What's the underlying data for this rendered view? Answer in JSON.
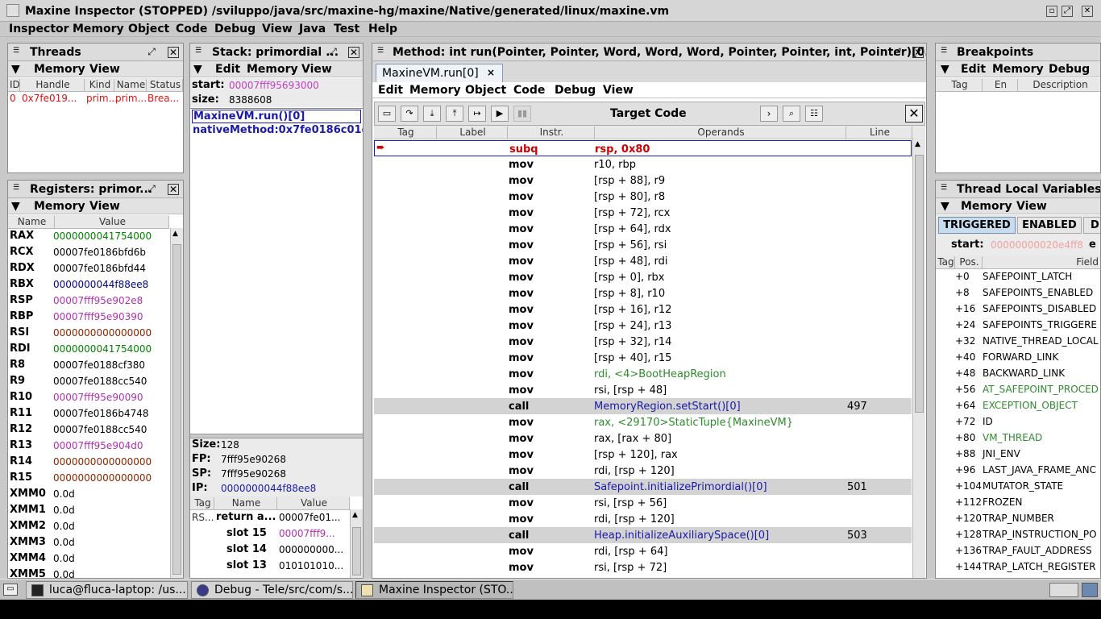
{
  "window": {
    "title": "Maxine Inspector (STOPPED) /sviluppo/java/src/maxine-hg/maxine/Native/generated/linux/maxine.vm",
    "menu": [
      "Inspector",
      "Memory",
      "Object",
      "Code",
      "Debug",
      "View",
      "Java",
      "Test",
      "Help"
    ]
  },
  "threads": {
    "title": "Threads",
    "menu": [
      "Memory",
      "View"
    ],
    "columns": [
      "ID",
      "Handle",
      "Kind",
      "Name",
      "Status"
    ],
    "row": [
      "0",
      "0x7fe019...",
      "prim...",
      "prim...",
      "Brea..."
    ]
  },
  "registers": {
    "title": "Registers: primor...",
    "menu": [
      "Memory",
      "View"
    ],
    "columns": [
      "Name",
      "Value"
    ],
    "rows": [
      {
        "name": "RAX",
        "value": "0000000041754000",
        "color": "#008000"
      },
      {
        "name": "RCX",
        "value": "00007fe0186bfd6b",
        "color": "#000000"
      },
      {
        "name": "RDX",
        "value": "00007fe0186bfd44",
        "color": "#000000"
      },
      {
        "name": "RBX",
        "value": "0000000044f88ee8",
        "color": "#00008b"
      },
      {
        "name": "RSP",
        "value": "00007fff95e902e8",
        "color": "#b030b0"
      },
      {
        "name": "RBP",
        "value": "00007fff95e90390",
        "color": "#b030b0"
      },
      {
        "name": "RSI",
        "value": "0000000000000000",
        "color": "#8b2500"
      },
      {
        "name": "RDI",
        "value": "0000000041754000",
        "color": "#008000"
      },
      {
        "name": "R8",
        "value": "00007fe0188cf380",
        "color": "#000000"
      },
      {
        "name": "R9",
        "value": "00007fe0188cc540",
        "color": "#000000"
      },
      {
        "name": "R10",
        "value": "00007fff95e90090",
        "color": "#b030b0"
      },
      {
        "name": "R11",
        "value": "00007fe0186b4748",
        "color": "#000000"
      },
      {
        "name": "R12",
        "value": "00007fe0188cc540",
        "color": "#000000"
      },
      {
        "name": "R13",
        "value": "00007fff95e904d0",
        "color": "#b030b0"
      },
      {
        "name": "R14",
        "value": "0000000000000000",
        "color": "#8b2500"
      },
      {
        "name": "R15",
        "value": "0000000000000000",
        "color": "#8b2500"
      },
      {
        "name": "XMM0",
        "value": "0.0d",
        "color": "#000000"
      },
      {
        "name": "XMM1",
        "value": "0.0d",
        "color": "#000000"
      },
      {
        "name": "XMM2",
        "value": "0.0d",
        "color": "#000000"
      },
      {
        "name": "XMM3",
        "value": "0.0d",
        "color": "#000000"
      },
      {
        "name": "XMM4",
        "value": "0.0d",
        "color": "#000000"
      },
      {
        "name": "XMM5",
        "value": "0.0d",
        "color": "#000000"
      }
    ]
  },
  "stack": {
    "title": "Stack: primordial ...",
    "menu": [
      "Edit",
      "Memory",
      "View"
    ],
    "start_label": "start:",
    "start_value": "00007fff95693000",
    "size_label": "size:",
    "size_value": "8388608",
    "frames": [
      "MaxineVM.run()[0]",
      "nativeMethod:0x7fe0186c01d4"
    ],
    "size2_label": "Size:",
    "size2_value": "128",
    "fp_label": "FP:",
    "fp_value": "7fff95e90268",
    "sp_label": "SP:",
    "sp_value": "7fff95e90268",
    "ip_label": "IP:",
    "ip_value": "0000000044f88ee8",
    "slot_columns": [
      "Tag",
      "Name",
      "Value"
    ],
    "slots": [
      {
        "tag": "RS...",
        "name": "return a...",
        "value": "00007fe01...",
        "color": "#000000"
      },
      {
        "tag": "",
        "name": "slot 15",
        "value": "00007fff9...",
        "color": "#b030b0"
      },
      {
        "tag": "",
        "name": "slot 14",
        "value": "000000000...",
        "color": "#000000"
      },
      {
        "tag": "",
        "name": "slot 13",
        "value": "010101010...",
        "color": "#000000"
      }
    ]
  },
  "method": {
    "title": "Method: int run(Pointer, Pointer, Word, Word, Word, Pointer, Pointer, int, Pointer)[0...",
    "tab": "MaxineVM.run[0]",
    "menu": [
      "Edit",
      "Memory",
      "Object",
      "Code",
      "Debug",
      "View"
    ],
    "toolbar_title": "Target Code",
    "columns": [
      "Tag",
      "Label",
      "Instr.",
      "Operands",
      "Line"
    ],
    "rows": [
      {
        "ins": "subq",
        "op": "rsp, 0x80",
        "line": "",
        "hl": false,
        "opcolor": "#d00000",
        "inscolor": "#d00000"
      },
      {
        "ins": "mov",
        "op": "r10, rbp",
        "line": "",
        "hl": false,
        "opcolor": "#000000",
        "inscolor": "#000000"
      },
      {
        "ins": "mov",
        "op": "[rsp + 88], r9",
        "line": "",
        "hl": false,
        "opcolor": "#000000",
        "inscolor": "#000000"
      },
      {
        "ins": "mov",
        "op": "[rsp + 80], r8",
        "line": "",
        "hl": false,
        "opcolor": "#000000",
        "inscolor": "#000000"
      },
      {
        "ins": "mov",
        "op": "[rsp + 72], rcx",
        "line": "",
        "hl": false,
        "opcolor": "#000000",
        "inscolor": "#000000"
      },
      {
        "ins": "mov",
        "op": "[rsp + 64], rdx",
        "line": "",
        "hl": false,
        "opcolor": "#000000",
        "inscolor": "#000000"
      },
      {
        "ins": "mov",
        "op": "[rsp + 56], rsi",
        "line": "",
        "hl": false,
        "opcolor": "#000000",
        "inscolor": "#000000"
      },
      {
        "ins": "mov",
        "op": "[rsp + 48], rdi",
        "line": "",
        "hl": false,
        "opcolor": "#000000",
        "inscolor": "#000000"
      },
      {
        "ins": "mov",
        "op": "[rsp + 0], rbx",
        "line": "",
        "hl": false,
        "opcolor": "#000000",
        "inscolor": "#000000"
      },
      {
        "ins": "mov",
        "op": "[rsp + 8], r10",
        "line": "",
        "hl": false,
        "opcolor": "#000000",
        "inscolor": "#000000"
      },
      {
        "ins": "mov",
        "op": "[rsp + 16], r12",
        "line": "",
        "hl": false,
        "opcolor": "#000000",
        "inscolor": "#000000"
      },
      {
        "ins": "mov",
        "op": "[rsp + 24], r13",
        "line": "",
        "hl": false,
        "opcolor": "#000000",
        "inscolor": "#000000"
      },
      {
        "ins": "mov",
        "op": "[rsp + 32], r14",
        "line": "",
        "hl": false,
        "opcolor": "#000000",
        "inscolor": "#000000"
      },
      {
        "ins": "mov",
        "op": "[rsp + 40], r15",
        "line": "",
        "hl": false,
        "opcolor": "#000000",
        "inscolor": "#000000"
      },
      {
        "ins": "mov",
        "op": "rdi, <4>BootHeapRegion",
        "line": "",
        "hl": false,
        "opcolor": "#2e8b2e",
        "inscolor": "#000000"
      },
      {
        "ins": "mov",
        "op": "rsi, [rsp + 48]",
        "line": "",
        "hl": false,
        "opcolor": "#000000",
        "inscolor": "#000000"
      },
      {
        "ins": "call",
        "op": "MemoryRegion.setStart()[0]",
        "line": "497",
        "hl": true,
        "opcolor": "#1a1aaa",
        "inscolor": "#000000"
      },
      {
        "ins": "mov",
        "op": "rax, <29170>StaticTuple{MaxineVM}",
        "line": "",
        "hl": false,
        "opcolor": "#2e8b2e",
        "inscolor": "#000000"
      },
      {
        "ins": "mov",
        "op": "rax, [rax + 80]",
        "line": "",
        "hl": false,
        "opcolor": "#000000",
        "inscolor": "#000000"
      },
      {
        "ins": "mov",
        "op": "[rsp + 120], rax",
        "line": "",
        "hl": false,
        "opcolor": "#000000",
        "inscolor": "#000000"
      },
      {
        "ins": "mov",
        "op": "rdi, [rsp + 120]",
        "line": "",
        "hl": false,
        "opcolor": "#000000",
        "inscolor": "#000000"
      },
      {
        "ins": "call",
        "op": "Safepoint.initializePrimordial()[0]",
        "line": "501",
        "hl": true,
        "opcolor": "#1a1aaa",
        "inscolor": "#000000"
      },
      {
        "ins": "mov",
        "op": "rsi, [rsp + 56]",
        "line": "",
        "hl": false,
        "opcolor": "#000000",
        "inscolor": "#000000"
      },
      {
        "ins": "mov",
        "op": "rdi, [rsp + 120]",
        "line": "",
        "hl": false,
        "opcolor": "#000000",
        "inscolor": "#000000"
      },
      {
        "ins": "call",
        "op": "Heap.initializeAuxiliarySpace()[0]",
        "line": "503",
        "hl": true,
        "opcolor": "#1a1aaa",
        "inscolor": "#000000"
      },
      {
        "ins": "mov",
        "op": "rdi, [rsp + 64]",
        "line": "",
        "hl": false,
        "opcolor": "#000000",
        "inscolor": "#000000"
      },
      {
        "ins": "mov",
        "op": "rsi, [rsp + 72]",
        "line": "",
        "hl": false,
        "opcolor": "#000000",
        "inscolor": "#000000"
      }
    ]
  },
  "breakpoints": {
    "title": "Breakpoints",
    "menu": [
      "Edit",
      "Memory",
      "Debug"
    ],
    "columns": [
      "Tag",
      "En",
      "Description"
    ]
  },
  "tlv": {
    "title": "Thread Local Variables:",
    "menu": [
      "Memory",
      "View"
    ],
    "tabs": [
      "TRIGGERED",
      "ENABLED",
      "D"
    ],
    "start_label": "start:",
    "start_value": "00000000020e4ff8",
    "start_trail": "e",
    "columns": [
      "Tag",
      "Pos.",
      "Field"
    ],
    "rows": [
      {
        "pos": "+0",
        "field": "SAFEPOINT_LATCH",
        "color": "#000000"
      },
      {
        "pos": "+8",
        "field": "SAFEPOINTS_ENABLED",
        "color": "#000000"
      },
      {
        "pos": "+16",
        "field": "SAFEPOINTS_DISABLED",
        "color": "#000000"
      },
      {
        "pos": "+24",
        "field": "SAFEPOINTS_TRIGGERE",
        "color": "#000000"
      },
      {
        "pos": "+32",
        "field": "NATIVE_THREAD_LOCAL",
        "color": "#000000"
      },
      {
        "pos": "+40",
        "field": "FORWARD_LINK",
        "color": "#000000"
      },
      {
        "pos": "+48",
        "field": "BACKWARD_LINK",
        "color": "#000000"
      },
      {
        "pos": "+56",
        "field": "AT_SAFEPOINT_PROCED",
        "color": "#2e8b2e"
      },
      {
        "pos": "+64",
        "field": "EXCEPTION_OBJECT",
        "color": "#2e8b2e"
      },
      {
        "pos": "+72",
        "field": "ID",
        "color": "#000000"
      },
      {
        "pos": "+80",
        "field": "VM_THREAD",
        "color": "#2e8b2e"
      },
      {
        "pos": "+88",
        "field": "JNI_ENV",
        "color": "#000000"
      },
      {
        "pos": "+96",
        "field": "LAST_JAVA_FRAME_ANC",
        "color": "#000000"
      },
      {
        "pos": "+104",
        "field": "MUTATOR_STATE",
        "color": "#000000"
      },
      {
        "pos": "+112",
        "field": "FROZEN",
        "color": "#000000"
      },
      {
        "pos": "+120",
        "field": "TRAP_NUMBER",
        "color": "#000000"
      },
      {
        "pos": "+128",
        "field": "TRAP_INSTRUCTION_PO",
        "color": "#000000"
      },
      {
        "pos": "+136",
        "field": "TRAP_FAULT_ADDRESS",
        "color": "#000000"
      },
      {
        "pos": "+144",
        "field": "TRAP_LATCH_REGISTER",
        "color": "#000000"
      }
    ]
  },
  "taskbar": {
    "items": [
      "luca@fluca-laptop: /us...",
      "Debug - Tele/src/com/s...",
      "Maxine Inspector (STO..."
    ]
  }
}
